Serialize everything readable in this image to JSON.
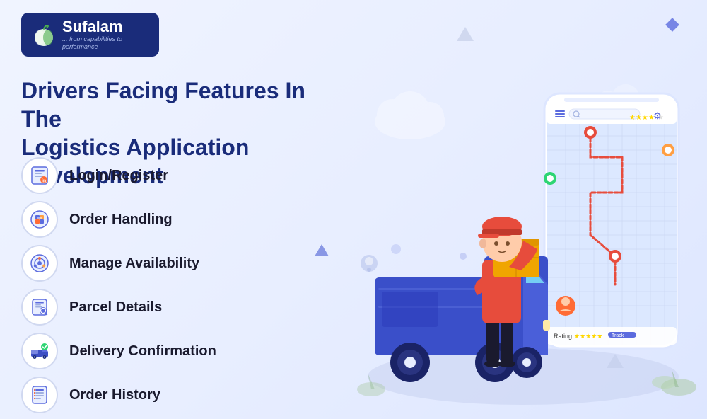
{
  "logo": {
    "name": "Sufalam",
    "tagline": "... from capabilities to performance",
    "icon": "🍎"
  },
  "heading": {
    "line1": "Drivers Facing Features In The",
    "line2": "Logistics Application Development"
  },
  "features": [
    {
      "id": "login",
      "label": "Login/Register",
      "icon": "🖥️"
    },
    {
      "id": "order-handling",
      "label": "Order Handling",
      "icon": "📦"
    },
    {
      "id": "manage-availability",
      "label": "Manage Availability",
      "icon": "⚙️"
    },
    {
      "id": "parcel-details",
      "label": "Parcel Details",
      "icon": "🔍"
    },
    {
      "id": "delivery-confirmation",
      "label": "Delivery Confirmation",
      "icon": "🚚"
    },
    {
      "id": "order-history",
      "label": "Order History",
      "icon": "📋"
    }
  ],
  "phone": {
    "search_placeholder": "Search...",
    "stars": 4
  },
  "decorations": {
    "triangle_color": "#c5cfe8",
    "diamond_color": "#5b6bde"
  }
}
